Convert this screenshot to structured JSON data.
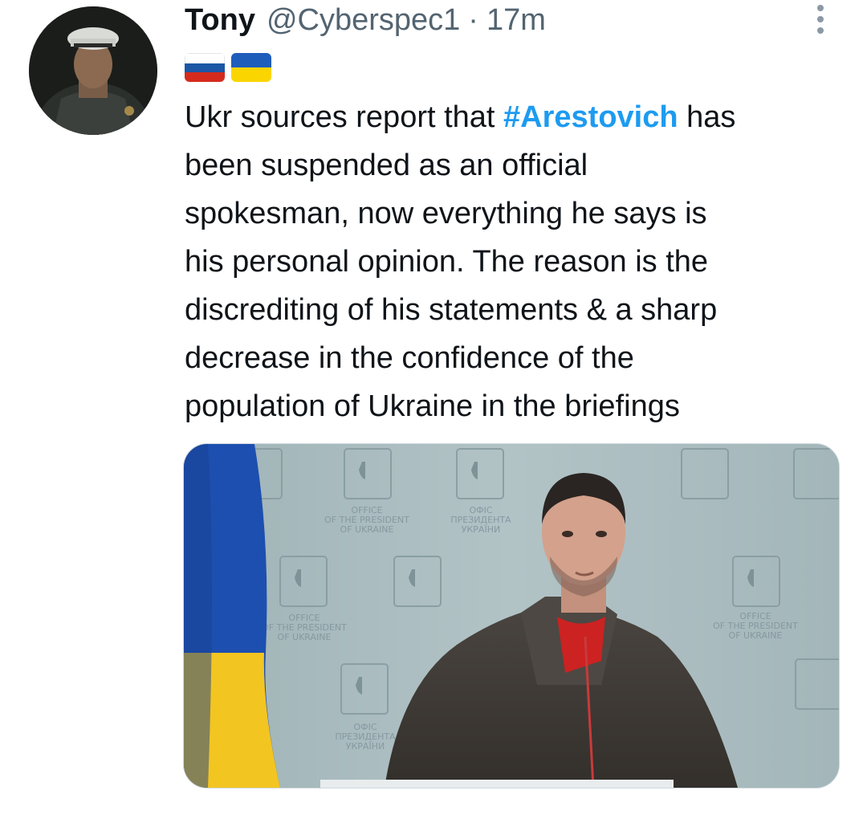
{
  "tweet": {
    "display_name": "Tony",
    "handle": "@Cyberspec1",
    "separator": "·",
    "time": "17m",
    "flags": [
      "flag-russia",
      "flag-ukraine"
    ],
    "text_before": "Ukr sources report that ",
    "hashtag": "#Arestovich",
    "text_after": " has\nbeen suspended as an official\nspokesman, now everything he says is\nhis personal opinion. The reason is the\ndiscrediting of his statements & a sharp\ndecrease in the confidence of the\npopulation of Ukraine in the briefings",
    "colors": {
      "hashtag": "#1d9bf0",
      "secondary_text": "#536471"
    }
  },
  "media": {
    "backdrop_text_en": [
      "OFFICE",
      "OF THE PRESIDENT",
      "OF UKRAINE"
    ],
    "backdrop_text_ua": [
      "ОФІС",
      "ПРЕЗИДЕНТА",
      "УКРАЇНИ"
    ]
  }
}
